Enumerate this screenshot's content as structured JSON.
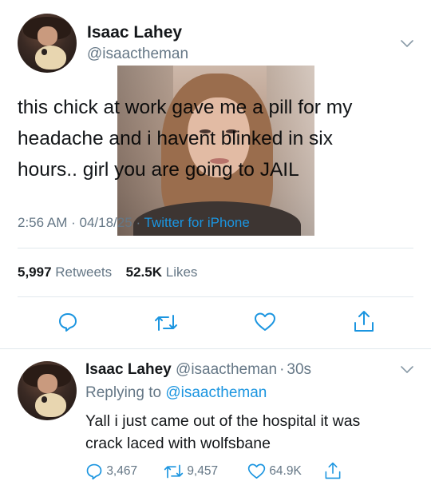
{
  "tweet": {
    "author_name": "Isaac Lahey",
    "author_handle": "@isaactheman",
    "text": "this chick at work gave me a pill for my\nheadache and i havent blinked in six\nhours.. girl you are going to JAIL",
    "time": "2:56 AM",
    "date": "04/18/25",
    "source": "Twitter for iPhone",
    "separator": "·",
    "retweet_count": "5,997",
    "retweet_label": "Retweets",
    "like_count": "52.5K",
    "like_label": "Likes"
  },
  "reply": {
    "author_name": "Isaac Lahey",
    "author_handle": "@isaactheman",
    "age": "30s",
    "separator": "·",
    "replying_label": "Replying to",
    "replying_handle": "@isaactheman",
    "text": "Yall i just came out of the hospital it was\ncrack laced with wolfsbane",
    "reply_count": "3,467",
    "retweet_count": "9,457",
    "like_count": "64.9K"
  },
  "colors": {
    "text": "#14171a",
    "muted": "#657786",
    "accent": "#1b95e0",
    "divider": "#e1e8ed"
  },
  "icons": {
    "reply": "reply-icon",
    "retweet": "retweet-icon",
    "like": "heart-icon",
    "share": "share-icon",
    "menu": "chevron-down-icon"
  }
}
